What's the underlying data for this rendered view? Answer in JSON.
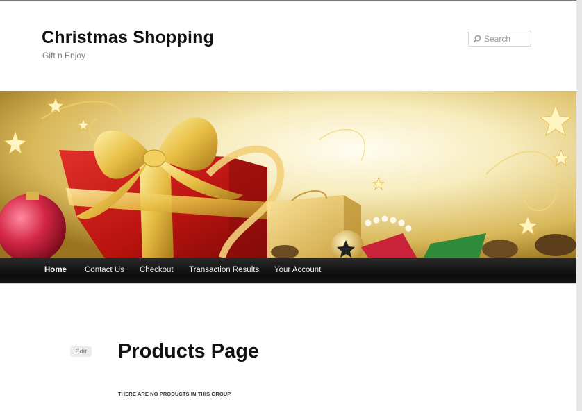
{
  "site": {
    "title": "Christmas Shopping",
    "tagline": "Gift n Enjoy"
  },
  "search": {
    "placeholder": "Search",
    "value": ""
  },
  "banner": {
    "icon": "gift-banner-image"
  },
  "nav": {
    "items": [
      {
        "label": "Home",
        "active": true
      },
      {
        "label": "Contact Us",
        "active": false
      },
      {
        "label": "Checkout",
        "active": false
      },
      {
        "label": "Transaction Results",
        "active": false
      },
      {
        "label": "Your Account",
        "active": false
      }
    ]
  },
  "content": {
    "edit_label": "Edit",
    "page_title": "Products Page",
    "empty_message": "There are no products in this group."
  },
  "colors": {
    "nav_background": "#111111",
    "accent_red": "#c6181a",
    "accent_gold": "#e4b93a"
  }
}
